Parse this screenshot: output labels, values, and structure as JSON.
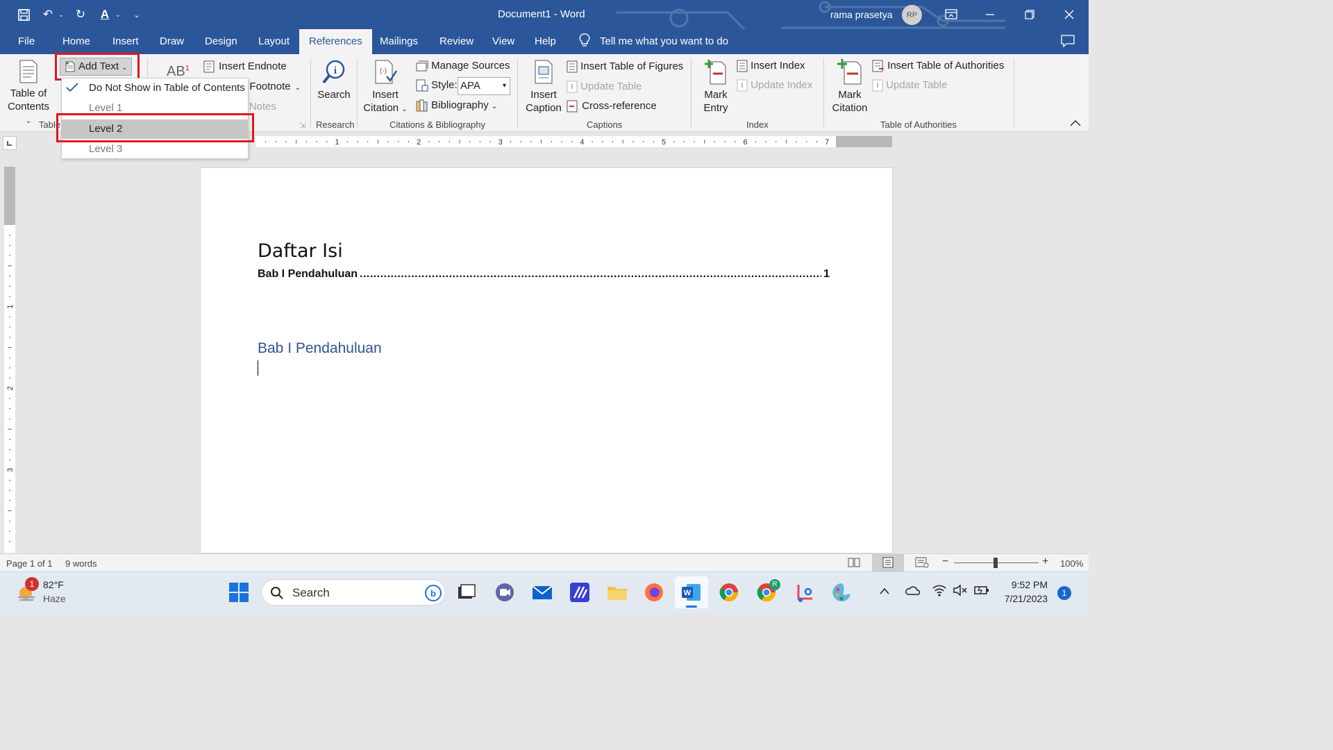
{
  "window": {
    "doc_title": "Document1  -  Word",
    "user_name": "rama prasetya",
    "avatar_initials": "RP"
  },
  "tabs": [
    "File",
    "Home",
    "Insert",
    "Draw",
    "Design",
    "Layout",
    "References",
    "Mailings",
    "Review",
    "View",
    "Help"
  ],
  "active_tab": "References",
  "tell_me": "Tell me what you want to do",
  "ribbon": {
    "toc_label_1": "Table of",
    "toc_label_2": "Contents",
    "group_toc": "Table of Contents",
    "add_text": "Add Text",
    "insert_endnote": "Insert Endnote",
    "next_footnote": "Next Footnote",
    "show_notes": "Show Notes",
    "search": "Search",
    "group_research": "Research",
    "insert_citation_1": "Insert",
    "insert_citation_2": "Citation",
    "manage_sources": "Manage Sources",
    "style_label": "Style:",
    "style_value": "APA",
    "bibliography": "Bibliography",
    "group_citations": "Citations & Bibliography",
    "insert_caption_1": "Insert",
    "insert_caption_2": "Caption",
    "insert_tof": "Insert Table of Figures",
    "update_table": "Update Table",
    "cross_reference": "Cross-reference",
    "group_captions": "Captions",
    "mark_entry_1": "Mark",
    "mark_entry_2": "Entry",
    "insert_index": "Insert Index",
    "update_index": "Update Index",
    "group_index": "Index",
    "mark_citation_1": "Mark",
    "mark_citation_2": "Citation",
    "insert_toa": "Insert Table of Authorities",
    "update_table_2": "Update Table",
    "group_toa": "Table of Authorities"
  },
  "dropdown": {
    "items": [
      "Do Not Show in Table of Contents",
      "Level 1",
      "Level 2",
      "Level 3"
    ],
    "checked": "Do Not Show in Table of Contents",
    "highlighted": "Level 2"
  },
  "ruler_numbers": [
    "1",
    "2",
    "3",
    "4",
    "5",
    "6",
    "7"
  ],
  "vruler_numbers": [
    "1",
    "2",
    "3"
  ],
  "document": {
    "heading": "Daftar Isi",
    "toc_entry": "Bab I Pendahuluan",
    "toc_page": "1",
    "heading1": "Bab I Pendahuluan"
  },
  "status": {
    "page": "Page 1 of 1",
    "words": "9 words",
    "zoom": "100%"
  },
  "taskbar": {
    "weather_temp": "82°F",
    "weather_desc": "Haze",
    "weather_badge": "1",
    "search": "Search",
    "time": "9:52 PM",
    "date": "7/21/2023",
    "notif_count": "1",
    "chrome_badge": "R"
  },
  "colors": {
    "word_blue": "#2b579a",
    "heading_blue": "#2f5496",
    "highlight_red": "#e3141f"
  }
}
